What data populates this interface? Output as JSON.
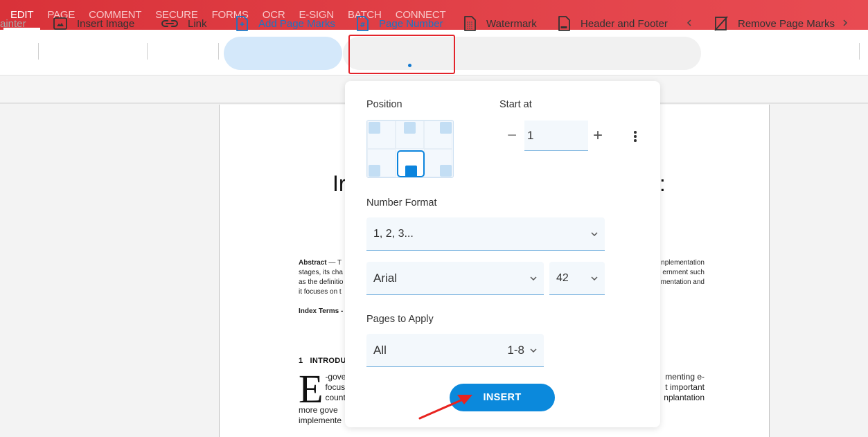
{
  "menubar": {
    "tabs": [
      {
        "label": "EDIT",
        "active": true
      },
      {
        "label": "PAGE"
      },
      {
        "label": "COMMENT"
      },
      {
        "label": "SECURE"
      },
      {
        "label": "FORMS"
      },
      {
        "label": "OCR"
      },
      {
        "label": "E-SIGN"
      },
      {
        "label": "BATCH"
      },
      {
        "label": "CONNECT"
      }
    ]
  },
  "toolbar": {
    "painter_partial": "ainter",
    "insert_image": "Insert Image",
    "link": "Link",
    "add_page_marks": "Add Page Marks",
    "page_number": "Page Number",
    "watermark": "Watermark",
    "header_footer": "Header and Footer",
    "remove_page_marks": "Remove Page Marks",
    "icons": {
      "insert_image": "image-icon",
      "link": "link-icon",
      "add_page_marks": "add-page-marks-icon",
      "page_number": "page-number-icon",
      "watermark": "watermark-icon",
      "header_footer": "header-footer-icon",
      "remove_page_marks": "remove-page-marks-icon",
      "collapse": "chevron-left-icon",
      "expand": "chevron-right-icon"
    }
  },
  "document": {
    "title_left": "Ir",
    "title_right": "t:",
    "abstract_label": "Abstract",
    "abstract_lines_left": [
      "— T",
      "stages, its cha",
      "as the definitio",
      "it focuses on t"
    ],
    "abstract_lines_right": [
      "nplementation",
      "ernment such",
      "mentation and"
    ],
    "index_terms": "Index Terms -",
    "section_number": "1",
    "section_title": "INTRODU",
    "dropcap": "E",
    "intro_lines_left": [
      "-gove",
      "focus",
      "count",
      "more  gove",
      "implemente"
    ],
    "intro_lines_right": [
      "menting  e-",
      "t  important",
      "nplantation"
    ]
  },
  "popup": {
    "position_label": "Position",
    "position_selected": "bottom-center",
    "start_at_label": "Start at",
    "start_at_value": "1",
    "minus_label": "−",
    "plus_label": "+",
    "number_format_label": "Number Format",
    "number_format_value": "1, 2, 3...",
    "font_value": "Arial",
    "font_size_value": "42",
    "pages_to_apply_label": "Pages to Apply",
    "pages_value": "All",
    "pages_range": "1-8",
    "insert_label": "INSERT"
  },
  "annotation": {
    "highlight_color": "#e3242b",
    "arrow_color": "#e8231f"
  },
  "colors": {
    "brand_red": "#d93239",
    "accent_blue": "#0b89dc",
    "active_text_blue": "#1279d0"
  }
}
